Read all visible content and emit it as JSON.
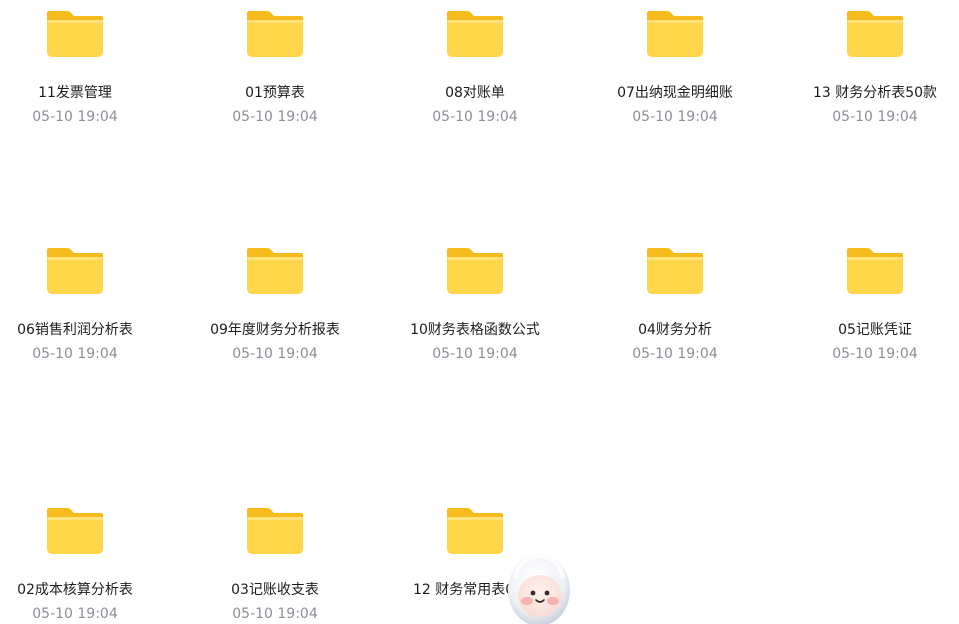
{
  "folders": [
    {
      "name": "11发票管理",
      "time": "05-10 19:04"
    },
    {
      "name": "01预算表",
      "time": "05-10 19:04"
    },
    {
      "name": "08对账单",
      "time": "05-10 19:04"
    },
    {
      "name": "07出纳现金明细账",
      "time": "05-10 19:04"
    },
    {
      "name": "13 财务分析表50款",
      "time": "05-10 19:04"
    },
    {
      "name": "06销售利润分析表",
      "time": "05-10 19:04"
    },
    {
      "name": "09年度财务分析报表",
      "time": "05-10 19:04"
    },
    {
      "name": "10财务表格函数公式",
      "time": "05-10 19:04"
    },
    {
      "name": "04财务分析",
      "time": "05-10 19:04"
    },
    {
      "name": "05记账凭证",
      "time": "05-10 19:04"
    },
    {
      "name": "02成本核算分析表",
      "time": "05-10 19:04"
    },
    {
      "name": "03记账收支表",
      "time": "05-10 19:04"
    },
    {
      "name": "12 财务常用表00款",
      "time": "05-10 19:04"
    }
  ],
  "colors": {
    "folder_front": "#ffd54a",
    "folder_back": "#f6bb1c",
    "name_text": "#1d1d1f",
    "time_text": "#8c8f96"
  },
  "icons": {
    "folder": "folder-icon",
    "mascot": "mascot-icon"
  }
}
